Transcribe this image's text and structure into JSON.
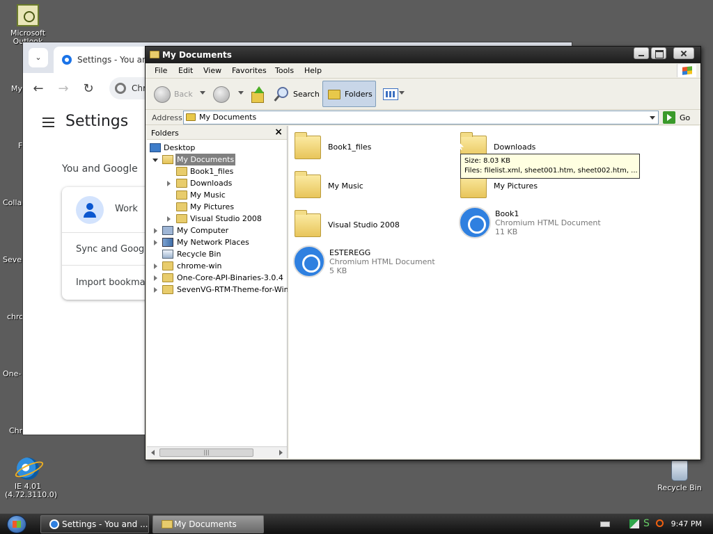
{
  "desktop": {
    "outlook_label": "Microsoft Outlook",
    "ie_label": "IE 4.01 (4.72.3110.0)",
    "recycle_label": "Recycle Bin",
    "edge_labels": [
      "My",
      "F",
      "Colla",
      "Seven",
      "chro",
      "One-",
      "Chr"
    ]
  },
  "chrome": {
    "tab_title": "Settings - You and Go",
    "omnibox_text": "Chron",
    "settings_title": "Settings",
    "section": "You and Google",
    "profile_name": "Work",
    "sync_label": "Sync and Google",
    "import_label": "Import bookmark"
  },
  "explorer": {
    "title": "My Documents",
    "menu": [
      "File",
      "Edit",
      "View",
      "Favorites",
      "Tools",
      "Help"
    ],
    "toolbar": {
      "back": "Back",
      "search": "Search",
      "folders": "Folders"
    },
    "address": {
      "label": "Address",
      "value": "My Documents",
      "go": "Go"
    },
    "folders_pane": {
      "header": "Folders",
      "close": "×",
      "tree": [
        {
          "label": "Desktop"
        },
        {
          "label": "My Documents"
        },
        {
          "label": "Book1_files"
        },
        {
          "label": "Downloads"
        },
        {
          "label": "My Music"
        },
        {
          "label": "My Pictures"
        },
        {
          "label": "Visual Studio 2008"
        },
        {
          "label": "My Computer"
        },
        {
          "label": "My Network Places"
        },
        {
          "label": "Recycle Bin"
        },
        {
          "label": "chrome-win"
        },
        {
          "label": "One-Core-API-Binaries-3.0.4"
        },
        {
          "label": "SevenVG-RTM-Theme-for-Wind"
        }
      ]
    },
    "items": [
      {
        "name": "Book1_files"
      },
      {
        "name": "Downloads"
      },
      {
        "name": "My Music"
      },
      {
        "name": "My Pictures"
      },
      {
        "name": "Visual Studio 2008"
      },
      {
        "name": "Book1",
        "type": "Chromium HTML Document",
        "size": "11 KB"
      },
      {
        "name": "ESTEREGG",
        "type": "Chromium HTML Document",
        "size": "5 KB"
      }
    ],
    "tooltip": {
      "line1": "Size: 8.03 KB",
      "line2": "Files: filelist.xml, sheet001.htm, sheet002.htm, ..."
    }
  },
  "taskbar": {
    "chrome_button": "Settings - You and ...",
    "docs_button": "My Documents",
    "clock": "9:47 PM"
  }
}
